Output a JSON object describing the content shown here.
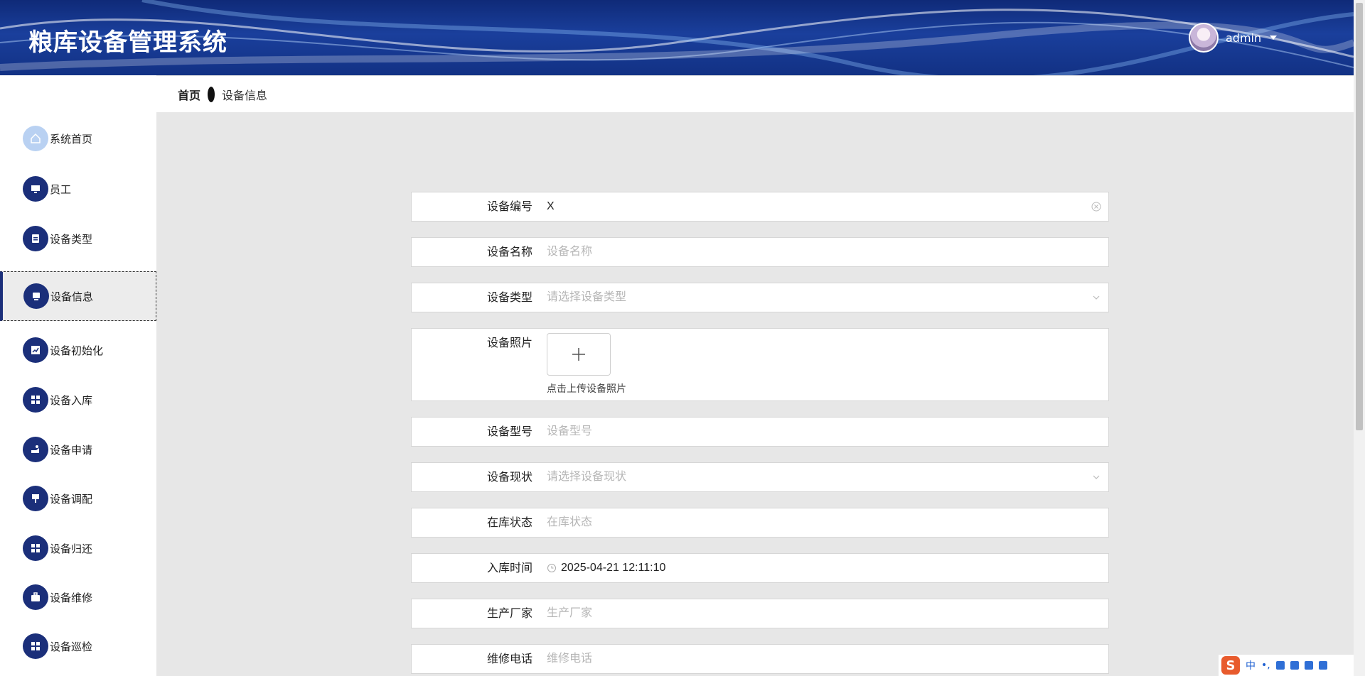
{
  "app": {
    "title": "粮库设备管理系统"
  },
  "user": {
    "name": "admin"
  },
  "breadcrumb": {
    "home": "首页",
    "current": "设备信息"
  },
  "sidebar": {
    "items": [
      {
        "label": "系统首页",
        "icon": "home-icon",
        "active": false
      },
      {
        "label": "员工",
        "icon": "monitor-icon",
        "active": false
      },
      {
        "label": "设备类型",
        "icon": "clipboard-icon",
        "active": false
      },
      {
        "label": "设备信息",
        "icon": "device-icon",
        "active": true
      },
      {
        "label": "设备初始化",
        "icon": "chart-icon",
        "active": false
      },
      {
        "label": "设备入库",
        "icon": "grid-icon",
        "active": false
      },
      {
        "label": "设备申请",
        "icon": "hand-icon",
        "active": false
      },
      {
        "label": "设备调配",
        "icon": "stamp-icon",
        "active": false
      },
      {
        "label": "设备归还",
        "icon": "grid-icon",
        "active": false
      },
      {
        "label": "设备维修",
        "icon": "briefcase-icon",
        "active": false
      },
      {
        "label": "设备巡检",
        "icon": "grid-icon",
        "active": false
      }
    ]
  },
  "form": {
    "code": {
      "label": "设备编号",
      "value": "X"
    },
    "name": {
      "label": "设备名称",
      "placeholder": "设备名称"
    },
    "type": {
      "label": "设备类型",
      "placeholder": "请选择设备类型"
    },
    "photo": {
      "label": "设备照片",
      "hint": "点击上传设备照片"
    },
    "model": {
      "label": "设备型号",
      "placeholder": "设备型号"
    },
    "status": {
      "label": "设备现状",
      "placeholder": "请选择设备现状"
    },
    "stock": {
      "label": "在库状态",
      "placeholder": "在库状态"
    },
    "intime": {
      "label": "入库时间",
      "value": "2025-04-21 12:11:10"
    },
    "maker": {
      "label": "生产厂家",
      "placeholder": "生产厂家"
    },
    "phone": {
      "label": "维修电话",
      "placeholder": "维修电话"
    }
  },
  "ime": {
    "lang": "中",
    "punct": "•,"
  },
  "colors": {
    "header": "#1a3f9c",
    "sidebar_icon": "#1b2f7a",
    "background": "#e7e7e7"
  }
}
